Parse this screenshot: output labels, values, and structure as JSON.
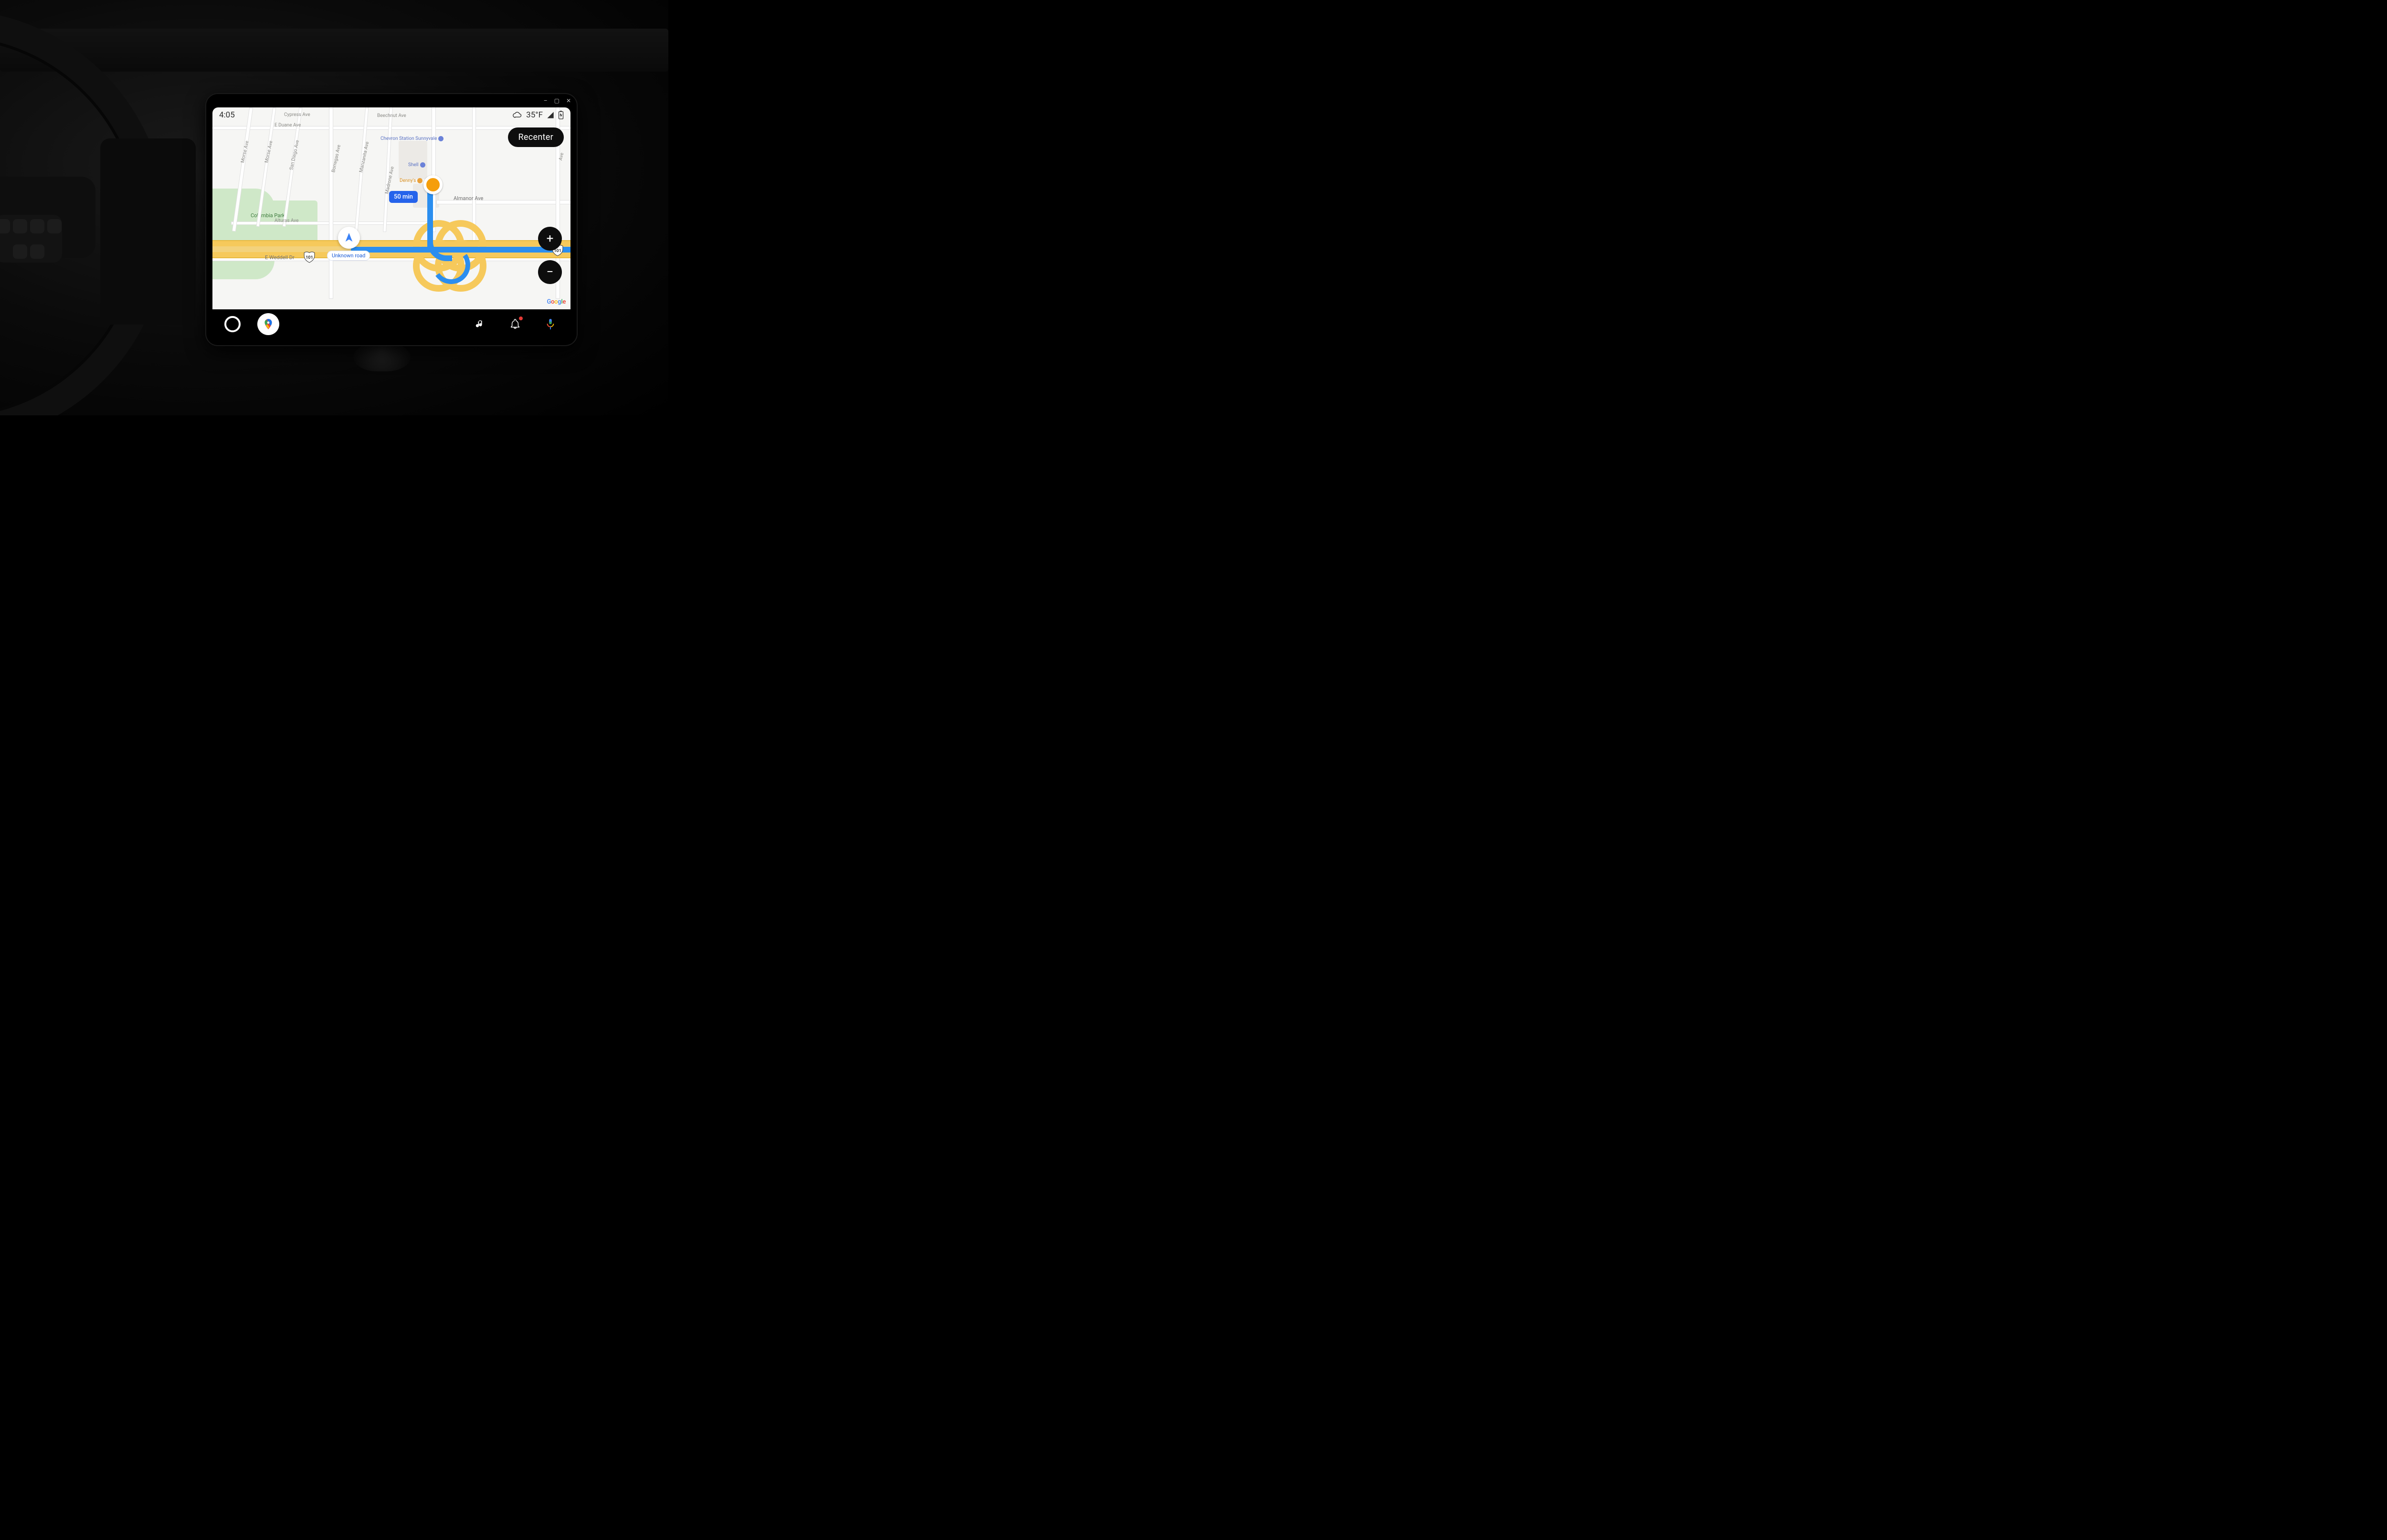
{
  "status_bar": {
    "time": "4:05",
    "weather_icon": "cloud-icon",
    "temperature": "35°F",
    "signal_icon": "cell-signal-icon",
    "battery_icon": "battery-charging-icon"
  },
  "window_controls": {
    "minimize": "–",
    "maximize": "▢",
    "close": "✕"
  },
  "map": {
    "recenter_label": "Recenter",
    "zoom_in_label": "+",
    "zoom_out_label": "−",
    "current_location_label": "Unknown road",
    "eta_chip": "50 min",
    "highway_shield": "101",
    "attribution": "Google",
    "park_label": "Columbia Park",
    "street_labels": {
      "morse": "Morse Ave",
      "morse2": "Morse Ave",
      "san_diego": "San Diego Ave",
      "borregas": "Borregas Ave",
      "manzanita": "Manzanita Ave",
      "madrone": "Madrone Ave",
      "cypress": "Cypress Ave",
      "e_duane": "E Duane Ave",
      "beechnut": "Beechnut Ave",
      "almanor": "Almanor Ave",
      "alturas": "Alturas Ave",
      "e_weddell": "E Weddell Dr",
      "ave_right": "Ave"
    },
    "pois": {
      "chevron": "Chevron Station Sunnyvale",
      "shell": "Shell",
      "dennys": "Denny's"
    }
  },
  "navbar": {
    "home": "home-button",
    "maps": "google-maps-button",
    "music": "music-button",
    "notifications": "notifications-button",
    "assistant": "voice-assistant-button"
  }
}
